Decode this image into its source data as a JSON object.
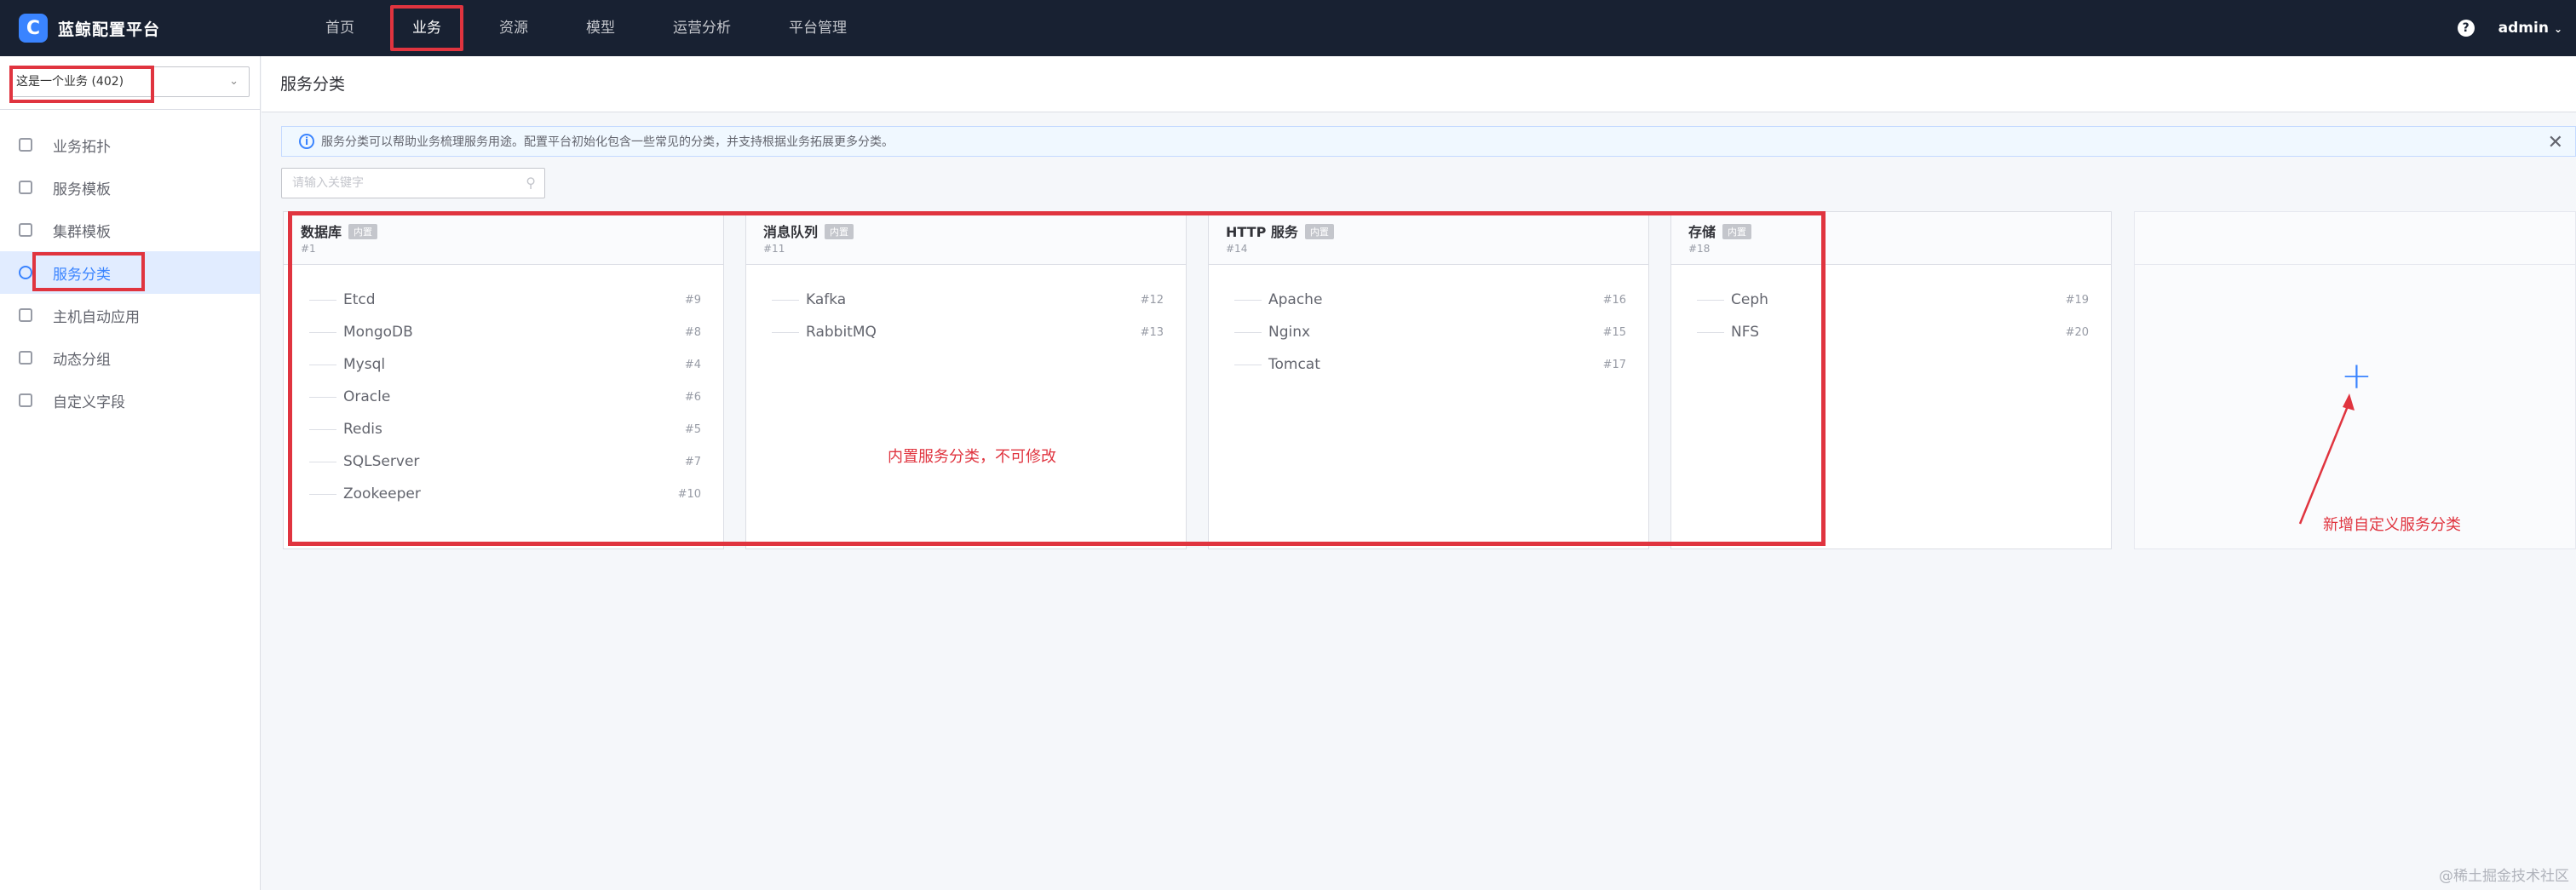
{
  "app": {
    "title": "蓝鲸配置平台",
    "logo_letter": "C"
  },
  "nav": {
    "items": [
      "首页",
      "业务",
      "资源",
      "模型",
      "运营分析",
      "平台管理"
    ],
    "active": 1
  },
  "user": {
    "name": "admin"
  },
  "sidebar": {
    "business_select": "这是一个业务 (402)",
    "items": [
      {
        "label": "业务拓扑",
        "icon": "topology-icon"
      },
      {
        "label": "服务模板",
        "icon": "service-template-icon"
      },
      {
        "label": "集群模板",
        "icon": "cluster-template-icon"
      },
      {
        "label": "服务分类",
        "icon": "service-category-icon"
      },
      {
        "label": "主机自动应用",
        "icon": "host-auto-apply-icon"
      },
      {
        "label": "动态分组",
        "icon": "dynamic-group-icon"
      },
      {
        "label": "自定义字段",
        "icon": "custom-field-icon"
      }
    ],
    "active": 3
  },
  "page": {
    "title": "服务分类",
    "alert": "服务分类可以帮助业务梳理服务用途。配置平台初始化包含一些常见的分类，并支持根据业务拓展更多分类。",
    "search_placeholder": "请输入关键字"
  },
  "categories": [
    {
      "name": "数据库",
      "badge": "内置",
      "id": "#1",
      "items": [
        [
          "Etcd",
          "#9"
        ],
        [
          "MongoDB",
          "#8"
        ],
        [
          "Mysql",
          "#4"
        ],
        [
          "Oracle",
          "#6"
        ],
        [
          "Redis",
          "#5"
        ],
        [
          "SQLServer",
          "#7"
        ],
        [
          "Zookeeper",
          "#10"
        ]
      ]
    },
    {
      "name": "消息队列",
      "badge": "内置",
      "id": "#11",
      "items": [
        [
          "Kafka",
          "#12"
        ],
        [
          "RabbitMQ",
          "#13"
        ]
      ]
    },
    {
      "name": "HTTP 服务",
      "badge": "内置",
      "id": "#14",
      "items": [
        [
          "Apache",
          "#16"
        ],
        [
          "Nginx",
          "#15"
        ],
        [
          "Tomcat",
          "#17"
        ]
      ]
    },
    {
      "name": "存储",
      "badge": "内置",
      "id": "#18",
      "items": [
        [
          "Ceph",
          "#19"
        ],
        [
          "NFS",
          "#20"
        ]
      ]
    }
  ],
  "annotations": {
    "builtin": "内置服务分类，不可修改",
    "add": "新增自定义服务分类"
  },
  "watermark": "@稀土掘金技术社区",
  "colors": {
    "nav_bg": "#182132",
    "accent": "#3a84ff",
    "annotation": "#e0343f"
  }
}
